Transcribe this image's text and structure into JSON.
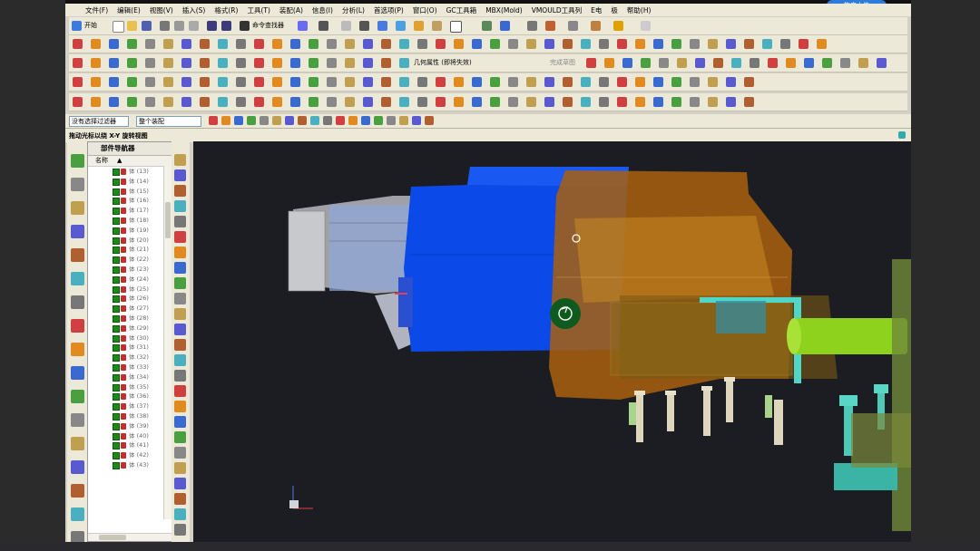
{
  "menu": [
    "文件(F)",
    "编辑(E)",
    "视图(V)",
    "插入(S)",
    "格式(R)",
    "工具(T)",
    "装配(A)",
    "信息(I)",
    "分析(L)",
    "首选项(P)",
    "窗口(O)",
    "GC工具箱",
    "MBX(Mold)",
    "VMOULD工具列",
    "E电",
    "极",
    "帮助(H)"
  ],
  "toolbar": {
    "start_label": "开始",
    "command_finder": "命令查找器",
    "geometry_props": "几何属性 (即将失效)",
    "sketch_label": "完成草图"
  },
  "selection": {
    "filter": "没有选择过滤器",
    "scope": "整个装配"
  },
  "hint": "拖动光标以绕 X-Y 旋转视图",
  "navigator": {
    "title": "部件导航器",
    "column_name": "名称",
    "items": [
      "体 (13)",
      "体 (14)",
      "体 (15)",
      "体 (16)",
      "体 (17)",
      "体 (18)",
      "体 (19)",
      "体 (20)",
      "体 (21)",
      "体 (22)",
      "体 (23)",
      "体 (24)",
      "体 (25)",
      "体 (26)",
      "体 (27)",
      "体 (28)",
      "体 (29)",
      "体 (30)",
      "体 (31)",
      "体 (32)",
      "体 (33)",
      "体 (34)",
      "体 (35)",
      "体 (36)",
      "体 (37)",
      "体 (38)",
      "体 (39)",
      "体 (40)",
      "体 (41)",
      "体 (42)",
      "体 (43)"
    ]
  },
  "upload_label": "拖曳上传",
  "colors": {
    "part_blue": "#0b49e8",
    "part_orange": "#a9600e",
    "part_green": "#8fd21e",
    "part_cyan": "#4fd6c6",
    "viewport": "#1c1d22"
  }
}
